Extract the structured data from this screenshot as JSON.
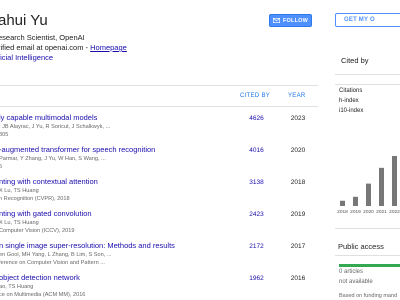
{
  "profile": {
    "name": "ahui Yu",
    "affiliation": "esearch Scientist, OpenAI",
    "email_text": "rified email at openai.com - ",
    "homepage_label": "Homepage",
    "interest": "ficial Intelligence"
  },
  "actions": {
    "follow_label": "FOLLOW",
    "get_label": "GET MY O"
  },
  "table": {
    "cited_by_header": "CITED BY",
    "year_header": "YEAR",
    "rows": [
      {
        "title": "ly capable multimodal models",
        "authors": ", JB Alayrac, J Yu, R Soricut, J Schalkwyk, ...",
        "venue": "305",
        "cites": "4626",
        "year": "2023"
      },
      {
        "title": "-augmented transformer for speech recognition",
        "authors": "Parmar, Y Zhang, J Yu, W Han, S Wang, ...",
        "venue": "5",
        "cites": "4016",
        "year": "2020"
      },
      {
        "title": "nting with contextual attention",
        "authors": "X Lu, TS Huang",
        "venue": "n Recognition (CVPR), 2018",
        "cites": "3138",
        "year": "2018"
      },
      {
        "title": "nting with gated convolution",
        "authors": "X Lu, TS Huang",
        "venue": "Computer Vision (ICCV), 2019",
        "cites": "2423",
        "year": "2019"
      },
      {
        "title": "n single image super-resolution: Methods and results",
        "authors": "en Gool, MH Yang, L Zhang, B Lim, S Son, ...",
        "venue": "ference on Computer Vision and Pattern ...",
        "cites": "2172",
        "year": "2017"
      },
      {
        "title": "object detection network",
        "authors": "ao, TS Huang",
        "venue": "ce on Multimedia (ACM MM), 2016",
        "cites": "1962",
        "year": "2016"
      }
    ]
  },
  "sidebar": {
    "cited_by_title": "Cited by",
    "metrics": [
      "Citations",
      "h-index",
      "i10-index"
    ],
    "public_access_title": "Public access",
    "articles_count": "0 articles",
    "status_text": "not available",
    "note": "Based on funding mand"
  },
  "chart_data": {
    "type": "bar",
    "categories": [
      "2018",
      "2019",
      "2020",
      "2021",
      "2022"
    ],
    "values": [
      4,
      7,
      17,
      29,
      38
    ],
    "color": "#777777"
  },
  "colors": {
    "accent": "#4d90fe",
    "link": "#1a0dab",
    "public_access_fill": "#34a853"
  }
}
